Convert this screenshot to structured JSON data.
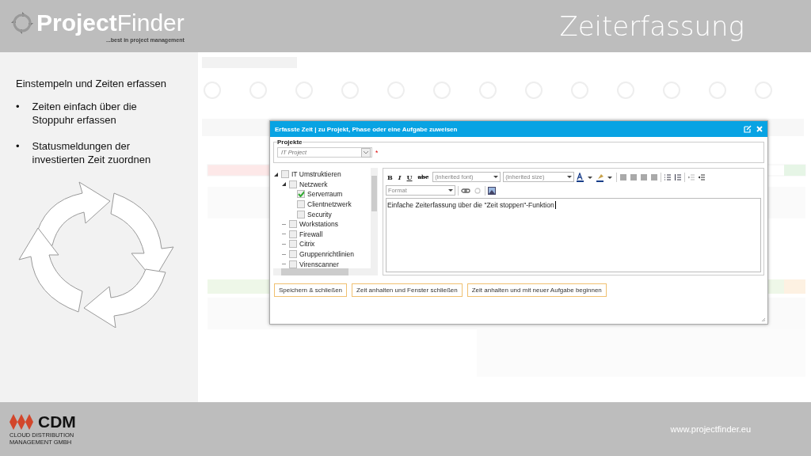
{
  "header": {
    "logo": {
      "name_bold": "Project",
      "name_light": "Finder",
      "tagline": "...best in project management"
    },
    "title": "Zeiterfassung"
  },
  "sidebar": {
    "heading": "Einstempeln und Zeiten erfassen",
    "bullets": [
      {
        "marker": "•",
        "text": "Zeiten einfach über die Stoppuhr erfassen"
      },
      {
        "marker": "•",
        "text": "Statusmeldungen der investierten Zeit zuordnen"
      }
    ]
  },
  "dialog": {
    "title": "Erfasste Zeit | zu Projekt, Phase oder eine Aufgabe zuweisen",
    "projects_label": "Projekte",
    "project_value": "IT Project",
    "required_mark": "*",
    "tree": [
      {
        "label": "IT Umstruktieren",
        "checked": false,
        "expanded": true,
        "children": [
          {
            "label": "Netzwerk",
            "checked": false,
            "expanded": true,
            "children": [
              {
                "label": "Serverraum",
                "checked": true
              },
              {
                "label": "Clientnetzwerk",
                "checked": false
              },
              {
                "label": "Security",
                "checked": false
              }
            ]
          },
          {
            "label": "Workstations",
            "checked": false,
            "expanded": false
          },
          {
            "label": "Firewall",
            "checked": false,
            "expanded": false
          },
          {
            "label": "Citrix",
            "checked": false,
            "expanded": false
          },
          {
            "label": "Gruppenrichtlinien",
            "checked": false,
            "expanded": false
          },
          {
            "label": "Virenscanner",
            "checked": false,
            "expanded": false
          }
        ]
      }
    ],
    "editor": {
      "style_buttons": [
        {
          "kind": "bold",
          "label": "B"
        },
        {
          "kind": "italic",
          "label": "I"
        },
        {
          "kind": "underline",
          "label": "U"
        },
        {
          "kind": "strike",
          "label": "abc"
        }
      ],
      "font": "(inherited font)",
      "size": "(inherited size)",
      "format": "Format",
      "text": "Einfache Zeiterfassung über die \"Zeit stoppen\"-Funktion"
    },
    "buttons": [
      "Speichern & schließen",
      "Zeit anhalten und Fenster schließen",
      "Zeit anhalten und mit neuer Aufgabe beginnen"
    ]
  },
  "footer": {
    "company": "CDM",
    "company_lines": [
      "CLOUD DISTRIBUTION",
      "MANAGEMENT GMBH"
    ],
    "url": "www.projectfinder.eu"
  }
}
